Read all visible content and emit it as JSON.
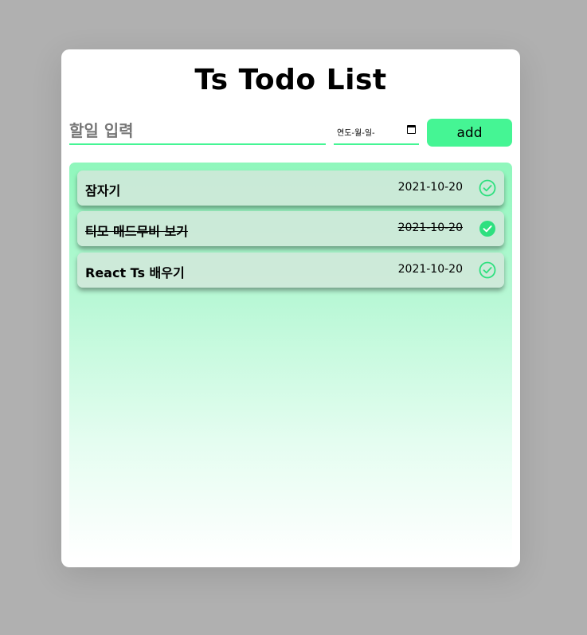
{
  "header": {
    "title": "Ts Todo List"
  },
  "form": {
    "input_placeholder": "할일 입력",
    "date_placeholder": "연도-월-일-",
    "add_label": "add"
  },
  "todos": [
    {
      "text": "잠자기",
      "date": "2021-10-20",
      "done": false
    },
    {
      "text": "티모 매드무비 보기",
      "date": "2021-10-20",
      "done": true
    },
    {
      "text": "React Ts 배우기",
      "date": "2021-10-20",
      "done": false
    }
  ],
  "colors": {
    "accent": "#45f594",
    "background": "#b0b0b0"
  },
  "icons": {
    "check": "check-circle-icon",
    "calendar": "calendar-icon"
  }
}
